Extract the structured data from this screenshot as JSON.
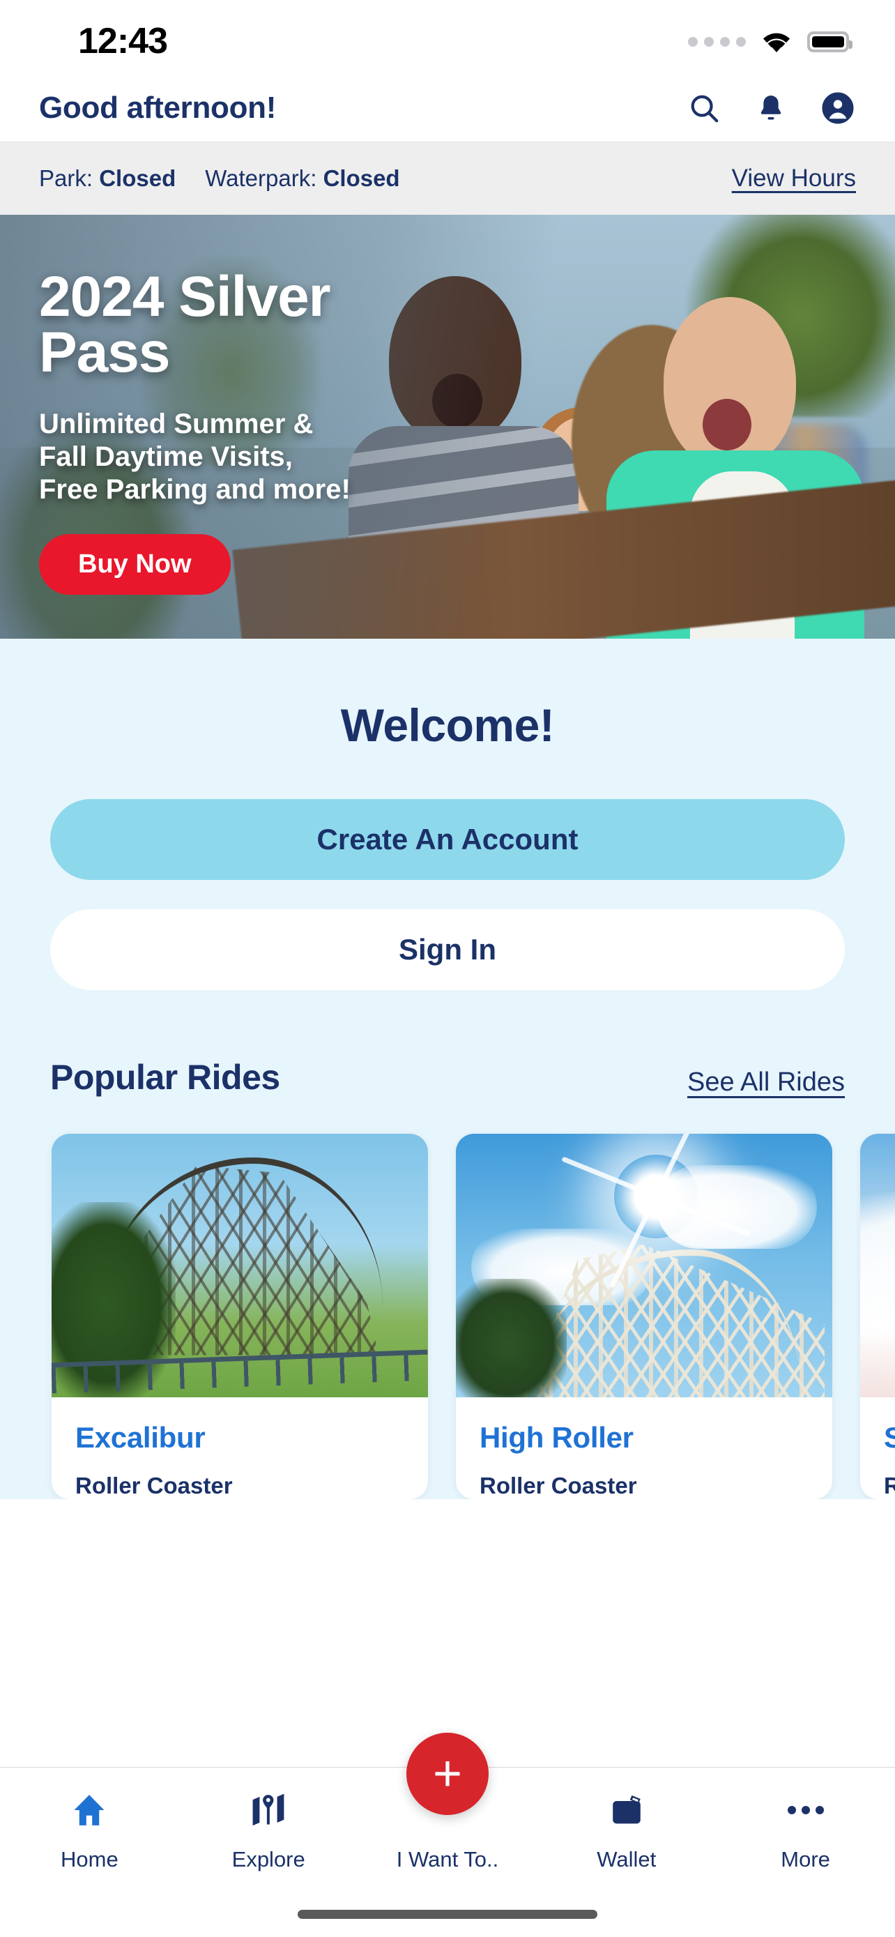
{
  "status_bar": {
    "time": "12:43",
    "signal_icon": "signal-dots-icon",
    "wifi_icon": "wifi-icon",
    "battery_icon": "battery-full-icon"
  },
  "header": {
    "greeting": "Good afternoon!",
    "icons": [
      {
        "name": "search-icon",
        "label": "Search"
      },
      {
        "name": "bell-icon",
        "label": "Notifications"
      },
      {
        "name": "account-circle-icon",
        "label": "Account"
      }
    ]
  },
  "park_status": {
    "park_label": "Park:",
    "park_value": "Closed",
    "waterpark_label": "Waterpark:",
    "waterpark_value": "Closed",
    "hours_link": "View Hours"
  },
  "hero": {
    "title_line1": "2024 Silver",
    "title_line2": "Pass",
    "subtitle_line1": "Unlimited Summer &",
    "subtitle_line2": "Fall Daytime Visits,",
    "subtitle_line3": "Free Parking and more!",
    "cta_label": "Buy Now",
    "cta_color": "#e8172c"
  },
  "welcome": {
    "title": "Welcome!",
    "create_account_label": "Create An Account",
    "sign_in_label": "Sign In",
    "primary_button_color": "#8ed8ec",
    "secondary_button_color": "#ffffff"
  },
  "popular_rides": {
    "section_title": "Popular Rides",
    "see_all_label": "See All Rides",
    "cards": [
      {
        "title": "Excalibur",
        "subtitle": "Roller Coaster"
      },
      {
        "title": "High Roller",
        "subtitle": "Roller Coaster"
      },
      {
        "title": "S",
        "subtitle": "R"
      }
    ]
  },
  "tab_bar": {
    "fab_label": "+",
    "items": [
      {
        "label": "Home",
        "icon": "home-icon",
        "active": true
      },
      {
        "label": "Explore",
        "icon": "map-pin-icon",
        "active": false
      },
      {
        "label": "I Want To..",
        "icon": "plus-icon",
        "active": false
      },
      {
        "label": "Wallet",
        "icon": "wallet-ticket-icon",
        "active": false
      },
      {
        "label": "More",
        "icon": "ellipsis-icon",
        "active": false
      }
    ]
  },
  "theme": {
    "navy": "#1b3168",
    "page_background": "#e7f5fc",
    "strip_background": "#eeeeee",
    "card_title_blue": "#1f72d4",
    "accent_red": "#d6262c"
  }
}
